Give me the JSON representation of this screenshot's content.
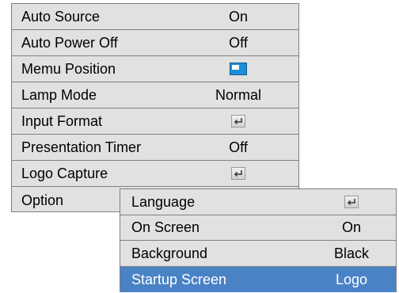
{
  "main_menu": {
    "items": [
      {
        "label": "Auto Source",
        "value": "On"
      },
      {
        "label": "Auto Power Off",
        "value": "Off"
      },
      {
        "label": "Memu Position",
        "icon": "menu-position-icon"
      },
      {
        "label": "Lamp Mode",
        "value": "Normal"
      },
      {
        "label": "Input Format",
        "icon": "enter-icon"
      },
      {
        "label": "Presentation Timer",
        "value": "Off"
      },
      {
        "label": "Logo Capture",
        "icon": "enter-icon"
      },
      {
        "label": "Option"
      }
    ]
  },
  "sub_menu": {
    "items": [
      {
        "label": "Language",
        "icon": "enter-icon"
      },
      {
        "label": "On Screen",
        "value": "On"
      },
      {
        "label": "Background",
        "value": "Black"
      },
      {
        "label": "Startup Screen",
        "value": "Logo",
        "selected": true
      }
    ]
  },
  "colors": {
    "menu_bg": "#e1e1e1",
    "selected_bg": "#4a82c6",
    "border": "#7f7f7f"
  }
}
